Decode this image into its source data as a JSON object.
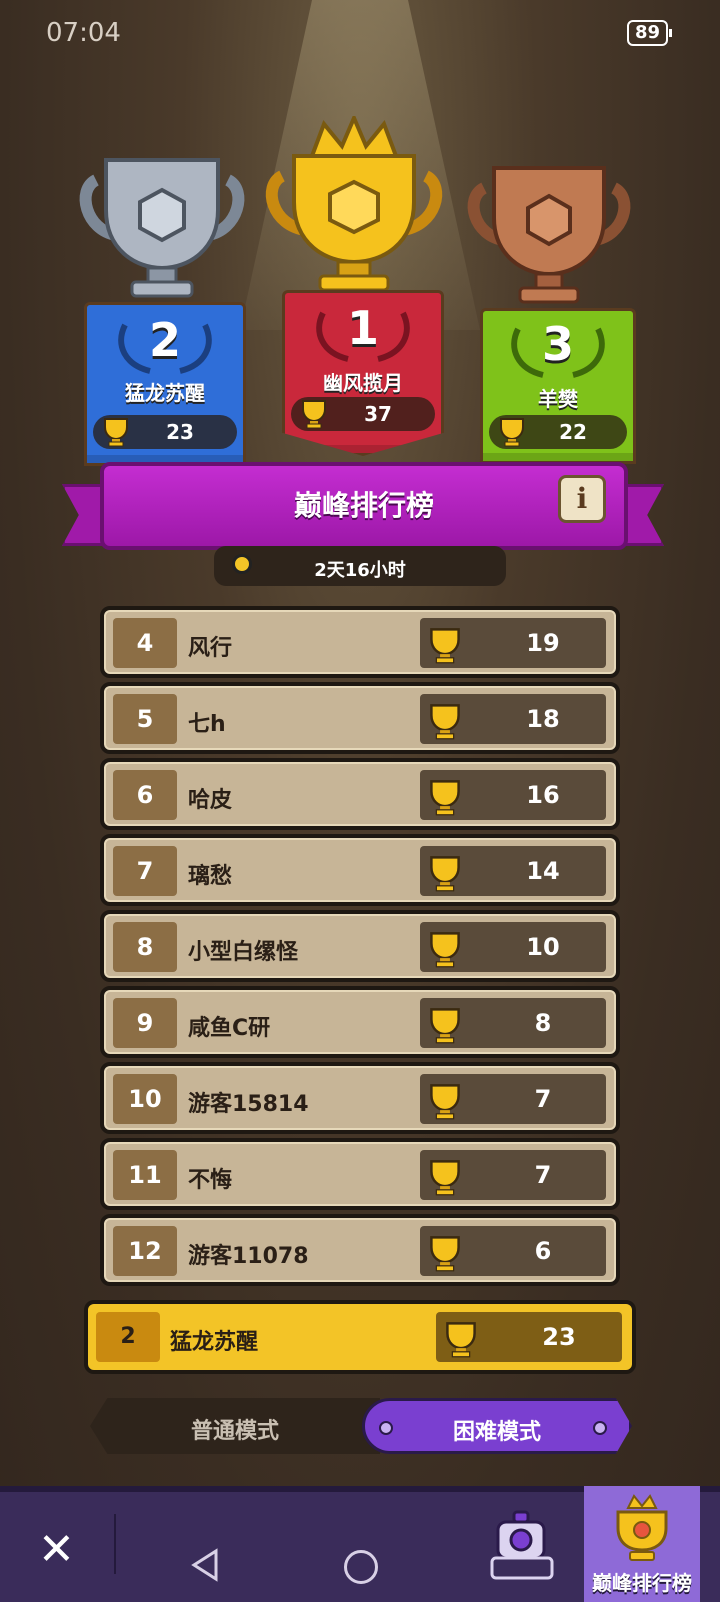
{
  "status_bar": {
    "time": "07:04",
    "battery": "89"
  },
  "podium": [
    {
      "rank": "2",
      "name": "猛龙苏醒",
      "score": "23",
      "color": "#2f6ed8"
    },
    {
      "rank": "1",
      "name": "幽风揽月",
      "score": "37",
      "color": "#c9283b"
    },
    {
      "rank": "3",
      "name": "羊樊",
      "score": "22",
      "color": "#7fc21a"
    }
  ],
  "leaderboard": {
    "title": "巅峰排行榜",
    "info_label": "i",
    "timer": "2天16小时",
    "rows": [
      {
        "rank": "4",
        "name": "风行",
        "score": "19"
      },
      {
        "rank": "5",
        "name": "七h",
        "score": "18"
      },
      {
        "rank": "6",
        "name": "哈皮",
        "score": "16"
      },
      {
        "rank": "7",
        "name": "璃愁",
        "score": "14"
      },
      {
        "rank": "8",
        "name": "小型白缧怪",
        "score": "10"
      },
      {
        "rank": "9",
        "name": "咸鱼C研",
        "score": "8"
      },
      {
        "rank": "10",
        "name": "游客15814",
        "score": "7"
      },
      {
        "rank": "11",
        "name": "不悔",
        "score": "7"
      },
      {
        "rank": "12",
        "name": "游客11078",
        "score": "6"
      }
    ],
    "my_row": {
      "rank": "2",
      "name": "猛龙苏醒",
      "score": "23"
    }
  },
  "modes": {
    "normal": "普通模式",
    "hard": "困难模式",
    "selected": "hard"
  },
  "bottom_nav": {
    "close_icon": "close-icon",
    "active_tab_label": "巅峰排行榜"
  }
}
